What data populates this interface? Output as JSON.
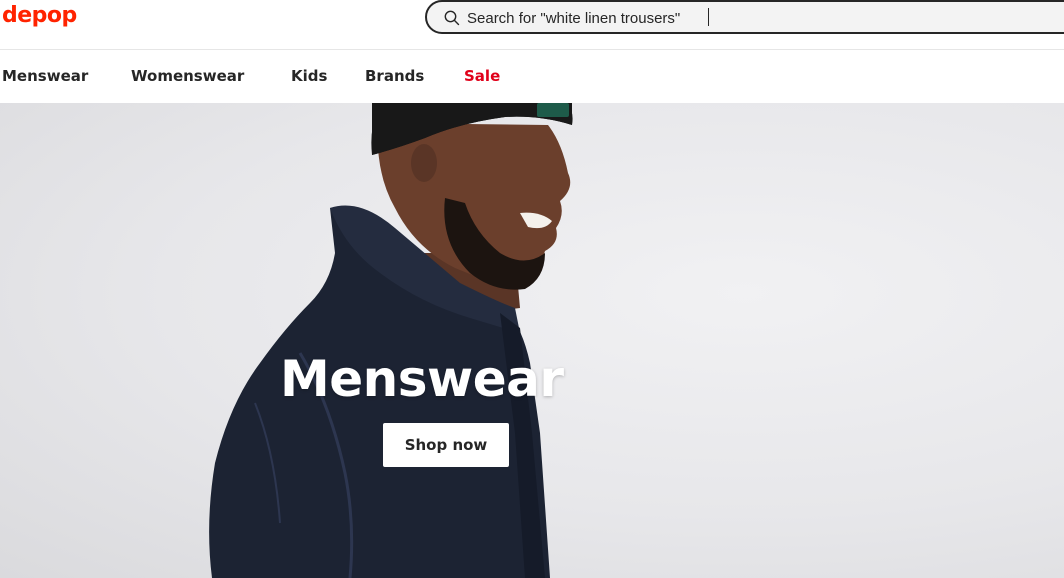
{
  "header": {
    "logo": "depop",
    "search": {
      "placeholder": "Search for \"white linen trousers\""
    }
  },
  "nav": {
    "items": [
      {
        "label": "Menswear"
      },
      {
        "label": "Womenswear"
      },
      {
        "label": "Kids"
      },
      {
        "label": "Brands"
      },
      {
        "label": "Sale"
      }
    ]
  },
  "hero": {
    "title": "Menswear",
    "cta": "Shop now"
  },
  "colors": {
    "brand": "#ff2300",
    "sale": "#e0001a",
    "text": "#262626"
  }
}
